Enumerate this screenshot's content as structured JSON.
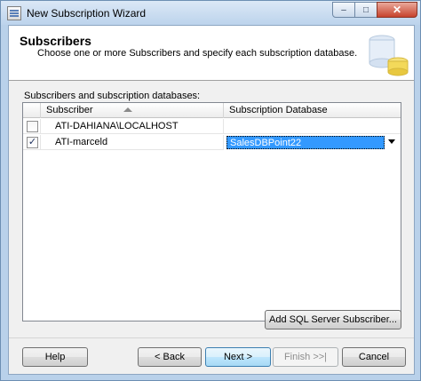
{
  "window": {
    "title": "New Subscription Wizard",
    "min_symbol": "–",
    "max_symbol": "□",
    "close_symbol": "✕"
  },
  "header": {
    "title": "Subscribers",
    "description": "Choose one or more Subscribers and specify each subscription database."
  },
  "grid": {
    "label": "Subscribers and subscription databases:",
    "columns": [
      "Subscriber",
      "Subscription Database"
    ],
    "rows": [
      {
        "checked": false,
        "check_mark": "",
        "subscriber": "ATI-DAHIANA\\LOCALHOST",
        "database": ""
      },
      {
        "checked": true,
        "check_mark": "✓",
        "subscriber": "ATI-marceld",
        "database": "SalesDBPoint22"
      }
    ]
  },
  "buttons": {
    "add_subscriber": "Add SQL Server Subscriber...",
    "help": "Help",
    "back": "< Back",
    "next": "Next >",
    "finish": "Finish >>|",
    "cancel": "Cancel"
  },
  "colors": {
    "selection": "#3399ff",
    "title_bar": "#bcd3ec",
    "close_button": "#c7422c"
  }
}
